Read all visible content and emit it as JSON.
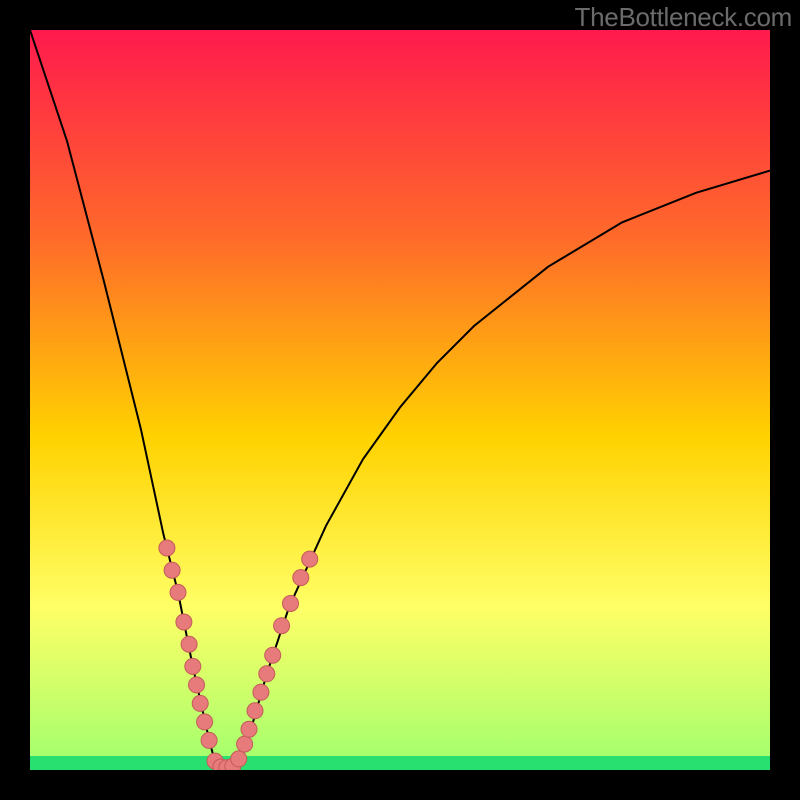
{
  "watermark": "TheBottleneck.com",
  "colors": {
    "gradient_top": "#ff1a4d",
    "gradient_mid1": "#ff6a2a",
    "gradient_mid2": "#ffd200",
    "gradient_mid3": "#ffff66",
    "gradient_bottom": "#9fff6e",
    "green_band": "#28e070",
    "curve": "#000000",
    "dot_fill": "#e77b7b",
    "dot_stroke": "#c35a5a",
    "frame": "#000000"
  },
  "chart_data": {
    "type": "line",
    "title": "",
    "xlabel": "",
    "ylabel": "",
    "xlim": [
      0,
      100
    ],
    "ylim": [
      0,
      100
    ],
    "optimum_x": 26,
    "curve": {
      "comment": "V-shaped bottleneck curve; y approaches 100 at extremes, 0 at optimum",
      "points": [
        {
          "x": 0,
          "y": 100
        },
        {
          "x": 5,
          "y": 85
        },
        {
          "x": 10,
          "y": 66
        },
        {
          "x": 15,
          "y": 46
        },
        {
          "x": 18,
          "y": 32
        },
        {
          "x": 20,
          "y": 24
        },
        {
          "x": 22,
          "y": 14
        },
        {
          "x": 24,
          "y": 5
        },
        {
          "x": 25,
          "y": 1
        },
        {
          "x": 26,
          "y": 0
        },
        {
          "x": 27,
          "y": 0
        },
        {
          "x": 28,
          "y": 1
        },
        {
          "x": 30,
          "y": 6
        },
        {
          "x": 32,
          "y": 13
        },
        {
          "x": 35,
          "y": 22
        },
        {
          "x": 40,
          "y": 33
        },
        {
          "x": 45,
          "y": 42
        },
        {
          "x": 50,
          "y": 49
        },
        {
          "x": 55,
          "y": 55
        },
        {
          "x": 60,
          "y": 60
        },
        {
          "x": 70,
          "y": 68
        },
        {
          "x": 80,
          "y": 74
        },
        {
          "x": 90,
          "y": 78
        },
        {
          "x": 100,
          "y": 81
        }
      ]
    },
    "series": [
      {
        "name": "sample-points",
        "type": "scatter",
        "values": [
          {
            "x": 18.5,
            "y": 30
          },
          {
            "x": 19.2,
            "y": 27
          },
          {
            "x": 20.0,
            "y": 24
          },
          {
            "x": 20.8,
            "y": 20
          },
          {
            "x": 21.5,
            "y": 17
          },
          {
            "x": 22.0,
            "y": 14
          },
          {
            "x": 22.5,
            "y": 11.5
          },
          {
            "x": 23.0,
            "y": 9
          },
          {
            "x": 23.6,
            "y": 6.5
          },
          {
            "x": 24.2,
            "y": 4
          },
          {
            "x": 25.0,
            "y": 1.2
          },
          {
            "x": 25.8,
            "y": 0.4
          },
          {
            "x": 26.6,
            "y": 0.3
          },
          {
            "x": 27.4,
            "y": 0.5
          },
          {
            "x": 28.2,
            "y": 1.5
          },
          {
            "x": 29.0,
            "y": 3.5
          },
          {
            "x": 29.6,
            "y": 5.5
          },
          {
            "x": 30.4,
            "y": 8
          },
          {
            "x": 31.2,
            "y": 10.5
          },
          {
            "x": 32.0,
            "y": 13
          },
          {
            "x": 32.8,
            "y": 15.5
          },
          {
            "x": 34.0,
            "y": 19.5
          },
          {
            "x": 35.2,
            "y": 22.5
          },
          {
            "x": 36.6,
            "y": 26
          },
          {
            "x": 37.8,
            "y": 28.5
          }
        ]
      }
    ]
  }
}
